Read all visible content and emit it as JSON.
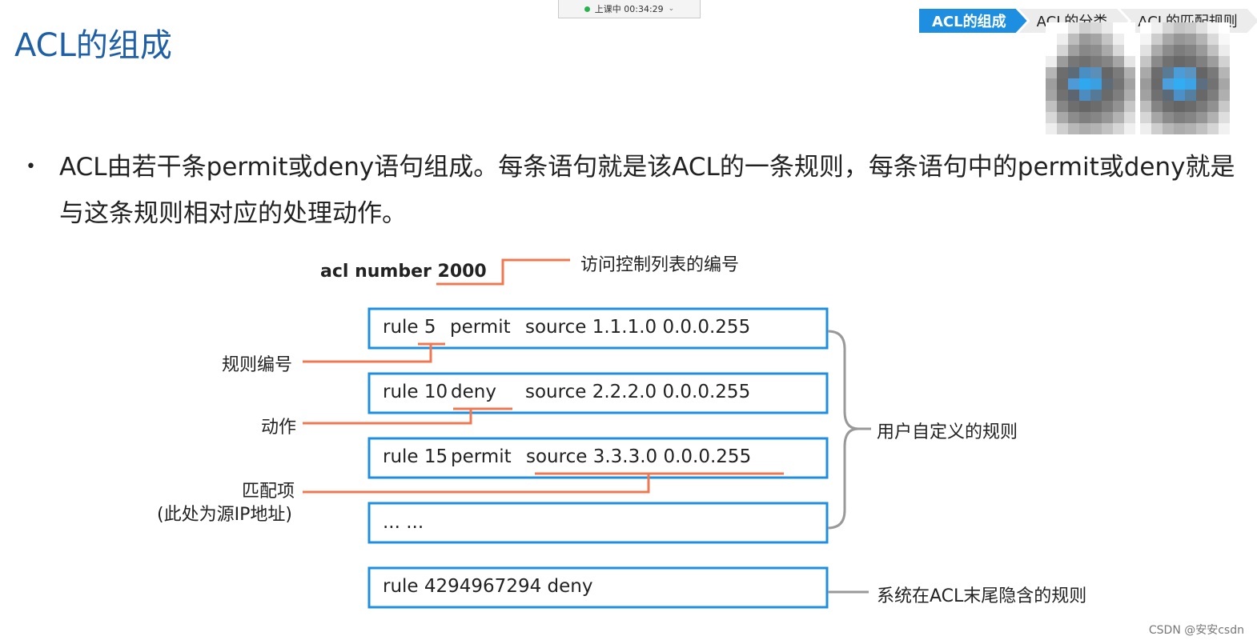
{
  "meeting_bar": {
    "status": "上课中 00:34:29"
  },
  "page_title": "ACL的组成",
  "nav_steps": [
    "ACL的组成",
    "ACL的分类",
    "ACL的匹配规则"
  ],
  "bullet_text": "ACL由若干条permit或deny语句组成。每条语句就是该ACL的一条规则，每条语句中的permit或deny就是与这条规则相对应的处理动作。",
  "diagram": {
    "acl_header": "acl number 2000",
    "acl_header_note": "访问控制列表的编号",
    "rules": [
      {
        "rule": "rule 5",
        "action": "permit",
        "source": "source 1.1.1.0 0.0.0.255"
      },
      {
        "rule": "rule 10",
        "action": "deny",
        "source": "source 2.2.2.0 0.0.0.255"
      },
      {
        "rule": "rule 15",
        "action": "permit",
        "source": "source 3.3.3.0 0.0.0.255"
      },
      {
        "rule": "... ...",
        "action": "",
        "source": ""
      }
    ],
    "implicit_rule": "rule 4294967294 deny",
    "left_labels": {
      "rule_number": "规则编号",
      "action": "动作",
      "match_item": "匹配项",
      "match_item_note": "(此处为源IP地址)"
    },
    "right_labels": {
      "user_defined": "用户自定义的规则",
      "implicit": "系统在ACL末尾隐含的规则"
    },
    "colors": {
      "box_border": "#1e8fe0",
      "callout_line": "#f07850",
      "bracket": "#999999"
    }
  },
  "watermark": "CSDN @安安csdn"
}
